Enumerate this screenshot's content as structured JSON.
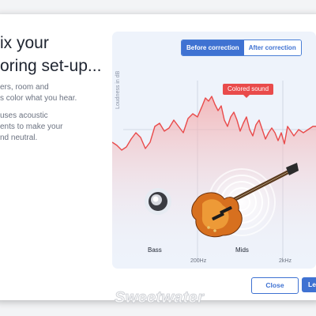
{
  "intro": {
    "headline_lines": [
      "ix your",
      "oring set-up..."
    ],
    "paragraph1_lines": [
      "ers, room and",
      "s color what you hear."
    ],
    "paragraph2_lines": [
      "uses acoustic",
      "ents to make your",
      "nd neutral."
    ]
  },
  "panel": {
    "tabs": [
      {
        "label": "Before correction",
        "active": true
      },
      {
        "label": "After correction",
        "active": false
      }
    ],
    "y_axis_label": "Loudness in dB",
    "callout": "Colored sound",
    "bands": [
      "Bass",
      "Mids"
    ],
    "freq_ticks": [
      "200Hz",
      "2kHz"
    ],
    "icons": [
      "speaker-icon",
      "sound-wave-icon",
      "guitar-icon"
    ]
  },
  "actions": {
    "close_label": "Close",
    "next_label": "Le"
  },
  "watermark": "Sweetwater",
  "colors": {
    "accent": "#3f72d2",
    "curve": "#e94b4b",
    "panel_bg": "#eef3fb"
  }
}
